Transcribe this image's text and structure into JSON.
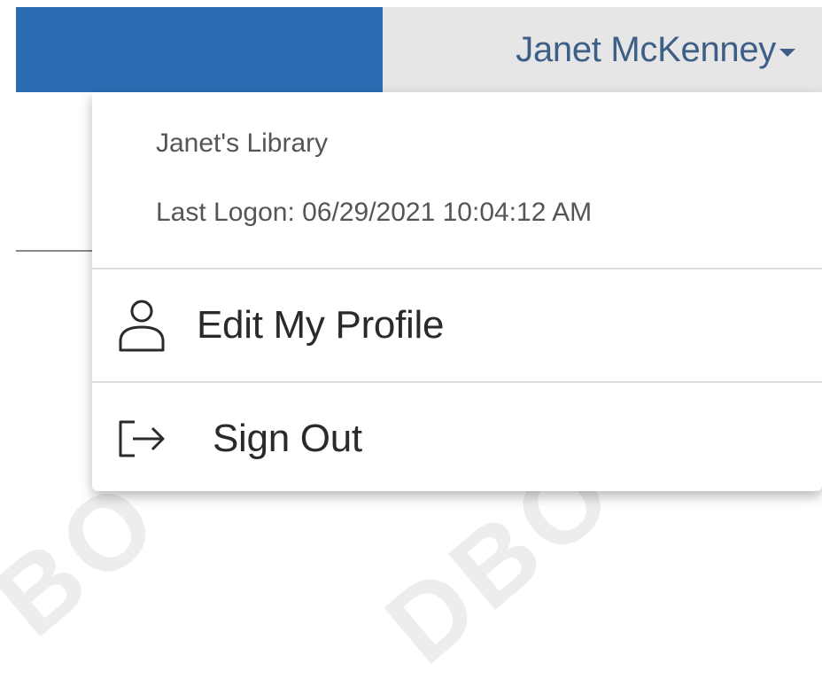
{
  "colors": {
    "brand": "#2b6cb4",
    "user_tab_bg": "#e6e6e6",
    "user_name_text": "#3d5f87"
  },
  "header": {
    "user_name": "Janet McKenney",
    "caret_icon": "caret-down-icon"
  },
  "dropdown": {
    "library_name": "Janet's Library",
    "last_logon": "Last Logon: 06/29/2021 10:04:12 AM",
    "items": [
      {
        "label": "Edit My Profile",
        "icon": "user-profile-icon"
      },
      {
        "label": "Sign Out",
        "icon": "sign-out-icon"
      }
    ]
  }
}
